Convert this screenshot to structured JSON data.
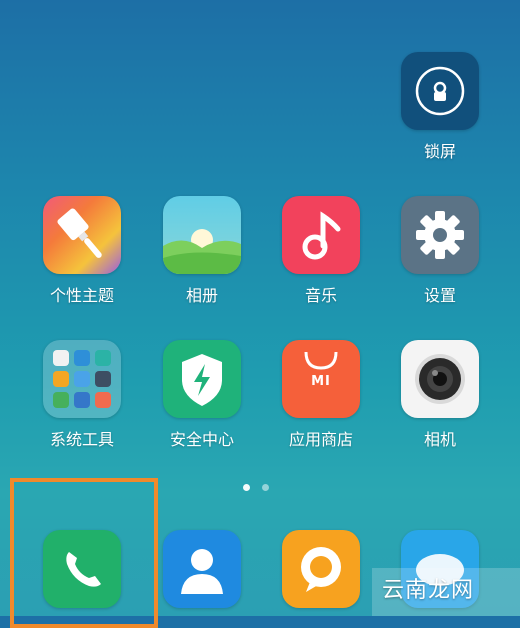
{
  "apps": {
    "lockscreen": "锁屏",
    "theme": "个性主题",
    "gallery": "相册",
    "music": "音乐",
    "settings": "设置",
    "tools": "系统工具",
    "security": "安全中心",
    "store": "应用商店",
    "camera": "相机"
  },
  "store_logo": "MI",
  "page_indicator": {
    "total": 2,
    "current": 1
  },
  "watermark": "云南龙网",
  "colors": {
    "highlight": "#f08a2c",
    "phone": "#21b06a",
    "contacts": "#1f8ae0",
    "messages": "#f7a21f"
  }
}
